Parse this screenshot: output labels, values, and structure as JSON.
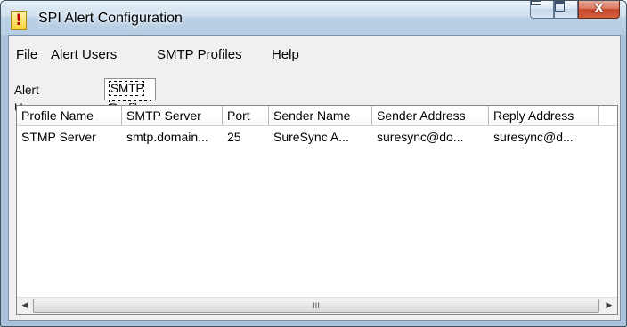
{
  "window": {
    "title": "SPI Alert Configuration",
    "app_icon_glyph": "!",
    "close_glyph": "X"
  },
  "menu": [
    {
      "label": "File",
      "mnemonic": "F",
      "rest": "ile"
    },
    {
      "label": "Alert Users",
      "mnemonic": "A",
      "rest": "lert Users"
    },
    {
      "label": "SMTP Profiles",
      "mnemonic": "",
      "rest": "SMTP Profiles"
    },
    {
      "label": "Help",
      "mnemonic": "H",
      "rest": "elp"
    }
  ],
  "tabs": [
    {
      "label": "Alert Users",
      "active": false
    },
    {
      "label": "SMTP Profiles",
      "active": true
    }
  ],
  "table": {
    "columns": [
      "Profile Name",
      "SMTP Server",
      "Port",
      "Sender Name",
      "Sender Address",
      "Reply Address"
    ],
    "rows": [
      [
        "STMP Server",
        "smtp.domain...",
        "25",
        "SureSync A...",
        "suresync@do...",
        "suresync@d..."
      ]
    ]
  },
  "scrollbar": {
    "left_arrow": "◀",
    "right_arrow": "▶",
    "grip": "III"
  },
  "colors": {
    "title_bar": "#b9d0e5",
    "close_button": "#c54829",
    "list_background": "#ffffff"
  }
}
